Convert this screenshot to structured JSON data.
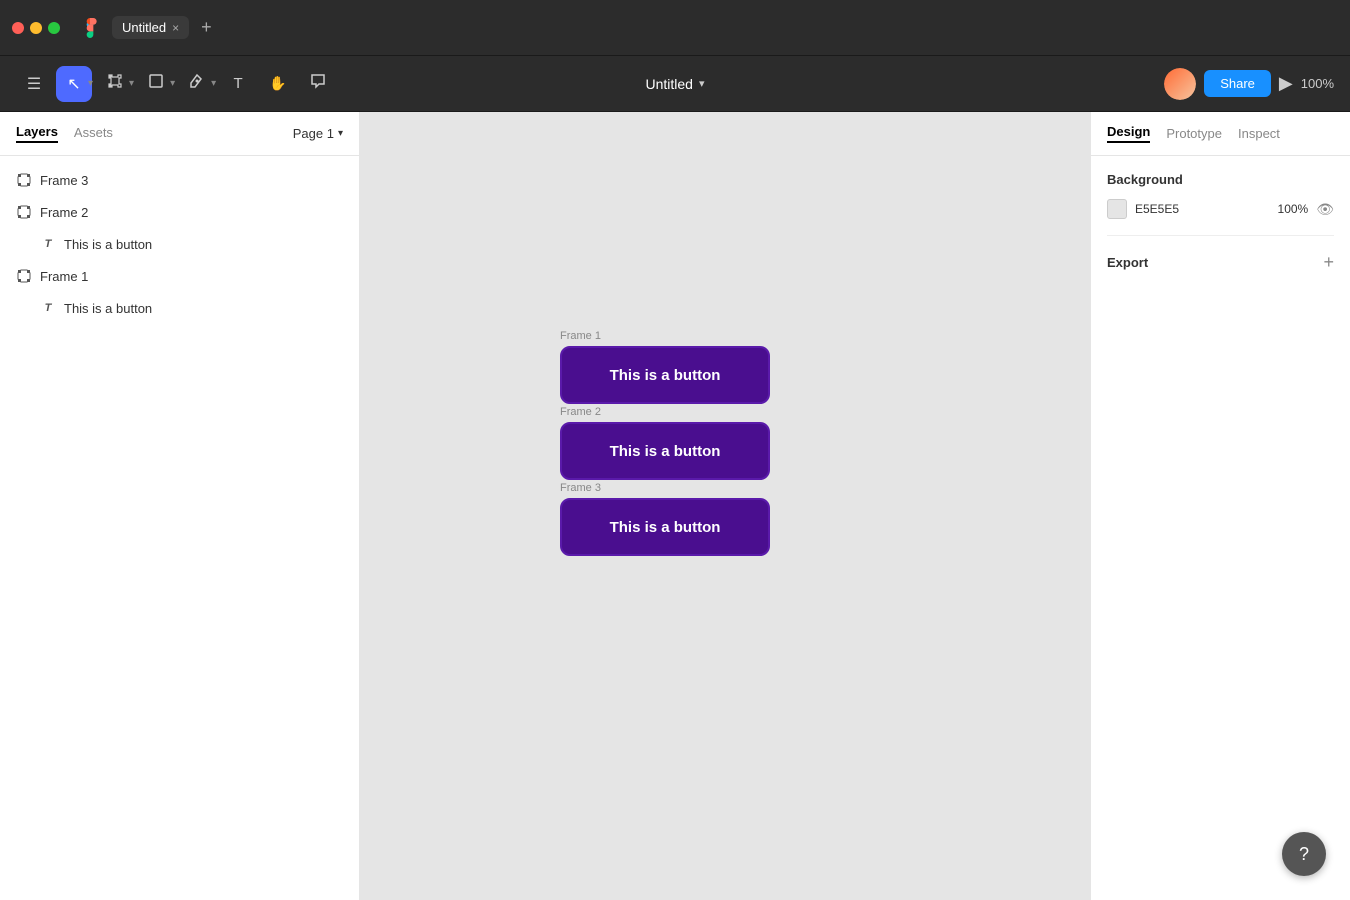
{
  "titlebar": {
    "tab_label": "Untitled",
    "tab_close": "×",
    "tab_add": "+",
    "figma_icon": "figma"
  },
  "toolbar": {
    "project_title": "Untitled",
    "project_dropdown": "▾",
    "share_label": "Share",
    "zoom_label": "100%",
    "tools": [
      {
        "name": "select",
        "icon": "▶",
        "active": true
      },
      {
        "name": "frame",
        "icon": "⊞",
        "active": false
      },
      {
        "name": "shape",
        "icon": "□",
        "active": false
      },
      {
        "name": "pen",
        "icon": "✒",
        "active": false
      },
      {
        "name": "text",
        "icon": "T",
        "active": false
      },
      {
        "name": "hand",
        "icon": "✋",
        "active": false
      },
      {
        "name": "comment",
        "icon": "💬",
        "active": false
      }
    ]
  },
  "sidebar": {
    "tabs": [
      "Layers",
      "Assets"
    ],
    "active_tab": "Layers",
    "page_selector_label": "Page 1",
    "layers": [
      {
        "id": "frame3",
        "label": "Frame 3",
        "type": "frame",
        "indent": false
      },
      {
        "id": "frame2",
        "label": "Frame 2",
        "type": "frame",
        "indent": false
      },
      {
        "id": "text2",
        "label": "This is a button",
        "type": "text",
        "indent": true
      },
      {
        "id": "frame1",
        "label": "Frame 1",
        "type": "frame",
        "indent": false
      },
      {
        "id": "text1",
        "label": "This is a button",
        "type": "text",
        "indent": true
      }
    ]
  },
  "canvas": {
    "background_color": "#e5e5e5",
    "frames": [
      {
        "id": "frame1",
        "label": "Frame 1",
        "button_text": "This is  a button"
      },
      {
        "id": "frame2",
        "label": "Frame 2",
        "button_text": "This is  a button"
      },
      {
        "id": "frame3",
        "label": "Frame 3",
        "button_text": "This is  a button"
      }
    ]
  },
  "right_panel": {
    "tabs": [
      "Design",
      "Prototype",
      "Inspect"
    ],
    "active_tab": "Design",
    "background_section": {
      "title": "Background",
      "color_hex": "E5E5E5",
      "opacity": "100%",
      "swatch_color": "#e5e5e5"
    },
    "export_section": {
      "title": "Export",
      "add_icon": "+"
    }
  },
  "help_button": {
    "icon": "?"
  }
}
